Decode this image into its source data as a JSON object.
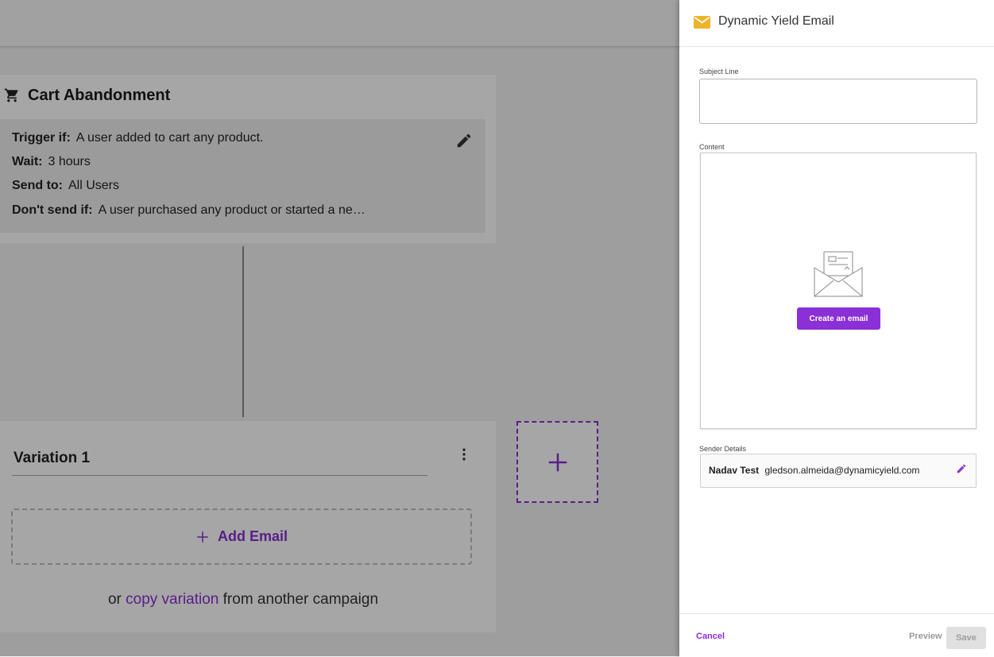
{
  "colors": {
    "accent": "#8b2fd6",
    "email_icon": "#f0b429",
    "overlay": "rgba(0,0,0,0.35)"
  },
  "trigger": {
    "title": "Cart Abandonment",
    "icon": "cart-icon",
    "rules": [
      {
        "label": "Trigger if:",
        "value": "A user added to cart any product."
      },
      {
        "label": "Wait:",
        "value": "3 hours"
      },
      {
        "label": "Send to:",
        "value": "All Users"
      },
      {
        "label": "Don't send if:",
        "value": "A user purchased any product or started a ne…"
      }
    ]
  },
  "variation": {
    "name": "Variation 1",
    "add_email_label": "Add Email",
    "copy_prefix": "or",
    "copy_link": "copy variation",
    "copy_suffix": "from another campaign"
  },
  "drawer": {
    "title": "Dynamic Yield Email",
    "subject": {
      "label": "Subject Line",
      "value": ""
    },
    "content": {
      "label": "Content",
      "create_button": "Create an email"
    },
    "sender": {
      "label": "Sender Details",
      "name": "Nadav Test",
      "email": "gledson.almeida@dynamicyield.com"
    },
    "footer": {
      "cancel": "Cancel",
      "preview": "Preview",
      "save": "Save"
    }
  }
}
